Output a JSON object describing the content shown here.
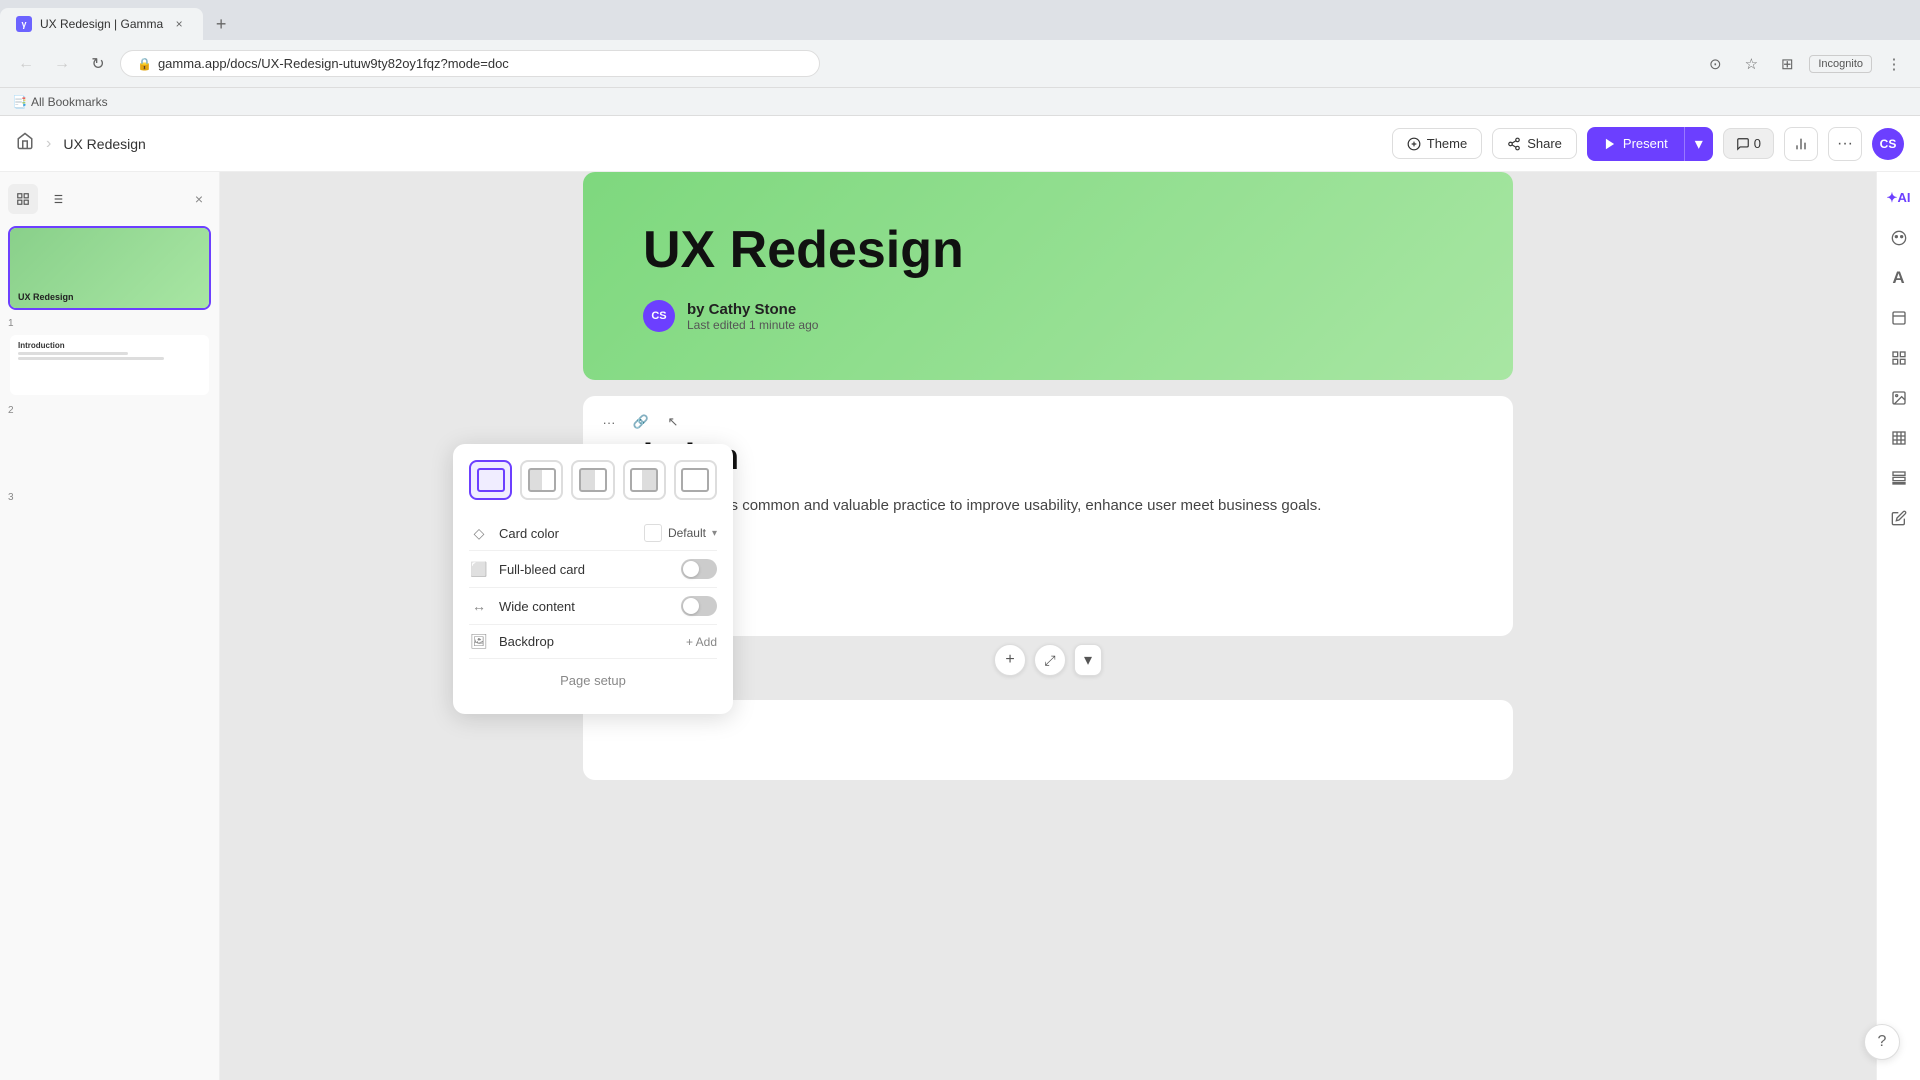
{
  "browser": {
    "tab_title": "UX Redesign | Gamma",
    "url": "gamma.app/docs/UX-Redesign-utuw9ty82oy1fqz?mode=doc",
    "incognito": "Incognito",
    "bookmarks_label": "All Bookmarks"
  },
  "header": {
    "home_label": "⌂",
    "separator": "›",
    "doc_title": "UX Redesign",
    "theme_label": "Theme",
    "share_label": "Share",
    "present_label": "Present",
    "comments_count": "0",
    "avatar_label": "CS"
  },
  "sidebar": {
    "slide1": {
      "label": "UX Redesign",
      "num": "1"
    },
    "slide2": {
      "label": "Introduction",
      "num": "2"
    },
    "slide3": {
      "num": "3"
    }
  },
  "cover": {
    "title": "UX Redesign",
    "author_label": "by Cathy Stone",
    "edit_label": "Last edited 1 minute ago",
    "avatar": "CS"
  },
  "card": {
    "section_title": "iction",
    "section_text": "website that is common and valuable practice to improve usability, enhance user meet business goals."
  },
  "card_popup": {
    "layout_options": [
      "full",
      "left-half",
      "left-third",
      "right-third",
      "minimal"
    ],
    "card_color_label": "Card color",
    "card_color_value": "Default",
    "full_bleed_label": "Full-bleed card",
    "wide_content_label": "Wide content",
    "backdrop_label": "Backdrop",
    "backdrop_add": "+ Add",
    "page_setup_label": "Page setup"
  },
  "between_cards": {
    "add_label": "+",
    "reorder_label": "⤢",
    "dropdown_label": "▾"
  },
  "help": {
    "label": "?"
  }
}
